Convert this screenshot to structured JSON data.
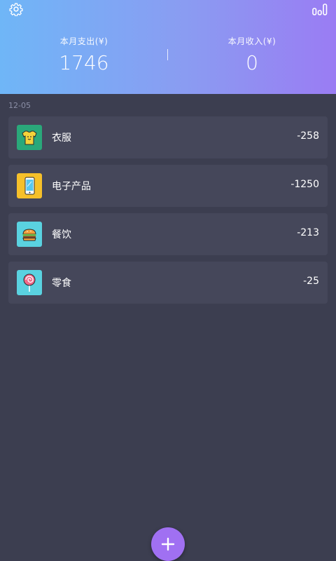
{
  "header": {
    "expense_label": "本月支出(¥)",
    "expense_value": "1746",
    "income_label": "本月收入(¥)",
    "income_value": "0"
  },
  "list": {
    "date": "12-05",
    "items": [
      {
        "name": "衣服",
        "amount": "-258",
        "icon": "tshirt-icon"
      },
      {
        "name": "电子产品",
        "amount": "-1250",
        "icon": "phone-icon"
      },
      {
        "name": "餐饮",
        "amount": "-213",
        "icon": "burger-icon"
      },
      {
        "name": "零食",
        "amount": "-25",
        "icon": "lollipop-icon"
      }
    ]
  },
  "icons": {
    "settings": "gear-icon",
    "statistics": "bar-chart-icon",
    "add": "plus-icon"
  },
  "colors": {
    "gradient_start": "#6fb6f7",
    "gradient_end": "#9a7cf3",
    "background": "#3c3e50",
    "card": "#45475a",
    "fab": "#a070f2"
  }
}
